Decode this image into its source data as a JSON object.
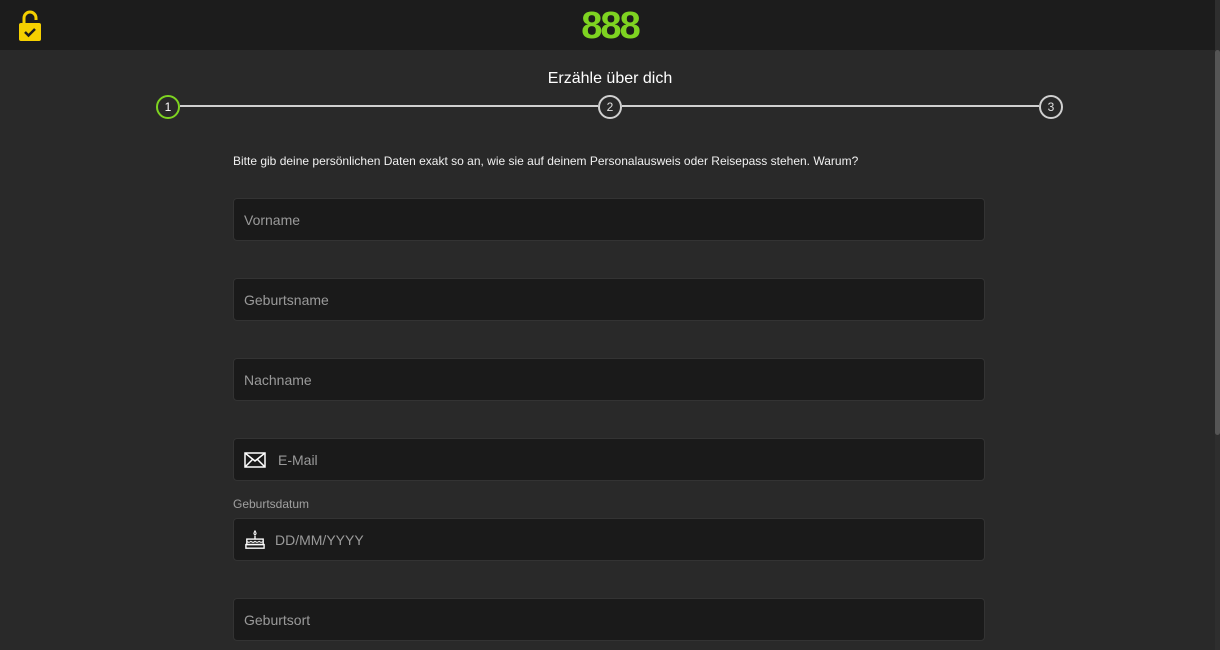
{
  "header": {
    "logo_text": "888",
    "colors": {
      "brand_green": "#7ed321",
      "lock_yellow": "#f5d000"
    },
    "lock_icon": "lock-check-icon"
  },
  "stepper": {
    "title": "Erzähle über dich",
    "steps": [
      {
        "number": "1",
        "active": true
      },
      {
        "number": "2",
        "active": false
      },
      {
        "number": "3",
        "active": false
      }
    ]
  },
  "form": {
    "intro_text": "Bitte gib deine persönlichen Daten exakt so an, wie sie auf deinem Personalausweis oder Reisepass stehen.",
    "why_link": "Warum?",
    "first_name": {
      "placeholder": "Vorname",
      "value": ""
    },
    "birth_name": {
      "placeholder": "Geburtsname",
      "value": ""
    },
    "last_name": {
      "placeholder": "Nachname",
      "value": ""
    },
    "email": {
      "placeholder": "E-Mail",
      "value": "",
      "icon": "envelope-icon"
    },
    "birthdate": {
      "label": "Geburtsdatum",
      "placeholder": "DD/MM/YYYY",
      "value": "",
      "icon": "birthday-cake-icon"
    },
    "birthplace": {
      "placeholder": "Geburtsort",
      "value": ""
    }
  }
}
